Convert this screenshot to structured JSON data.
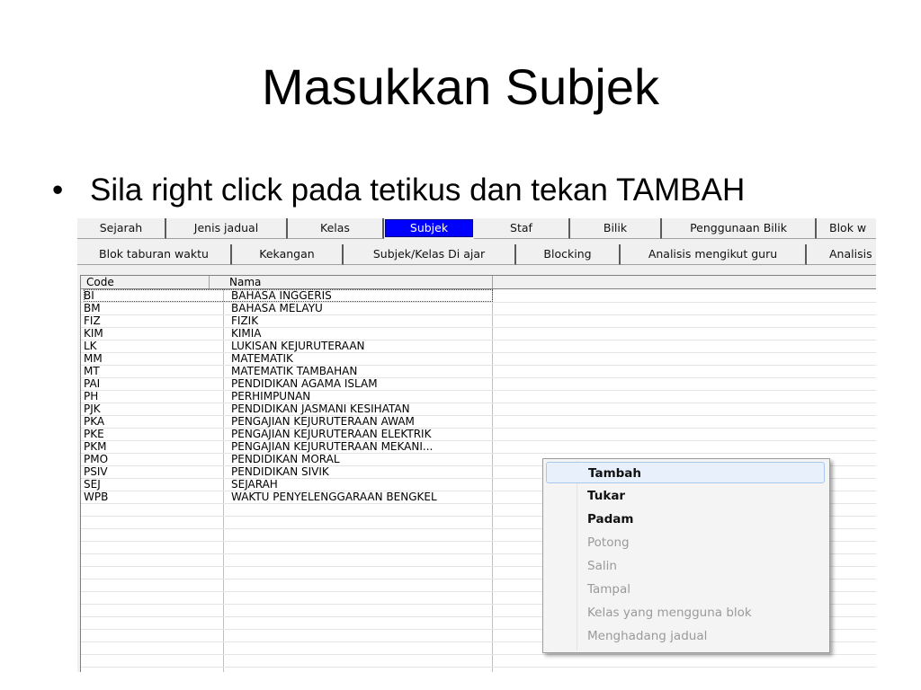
{
  "slide": {
    "title": "Masukkan Subjek",
    "bullet": "•",
    "instruction": "Sila right click pada tetikus dan tekan TAMBAH"
  },
  "tabs_row1": [
    "Sejarah",
    "Jenis jadual",
    "Kelas",
    "Subjek",
    "Staf",
    "Bilik",
    "Penggunaan Bilik",
    "Blok w"
  ],
  "tabs_row1_active": "Subjek",
  "tabs_row2": [
    "Blok taburan waktu",
    "Kekangan",
    "Subjek/Kelas Di ajar",
    "Blocking",
    "Analisis mengikut guru",
    "Analisis"
  ],
  "grid": {
    "columns": [
      "Code",
      "Nama"
    ],
    "rows": [
      [
        "BI",
        "BAHASA INGGERIS"
      ],
      [
        "BM",
        "BAHASA MELAYU"
      ],
      [
        "FIZ",
        "FIZIK"
      ],
      [
        "KIM",
        "KIMIA"
      ],
      [
        "LK",
        "LUKISAN KEJURUTERAAN"
      ],
      [
        "MM",
        "MATEMATIK"
      ],
      [
        "MT",
        "MATEMATIK TAMBAHAN"
      ],
      [
        "PAI",
        "PENDIDIKAN AGAMA ISLAM"
      ],
      [
        "PH",
        "PERHIMPUNAN"
      ],
      [
        "PJK",
        "PENDIDIKAN JASMANI KESIHATAN"
      ],
      [
        "PKA",
        "PENGAJIAN KEJURUTERAAN AWAM"
      ],
      [
        "PKE",
        "PENGAJIAN KEJURUTERAAN ELEKTRIK"
      ],
      [
        "PKM",
        "PENGAJIAN KEJURUTERAAN MEKANI..."
      ],
      [
        "PMO",
        "PENDIDIKAN MORAL"
      ],
      [
        "PSIV",
        "PENDIDIKAN SIVIK"
      ],
      [
        "SEJ",
        "SEJARAH"
      ],
      [
        "WPB",
        "WAKTU PENYELENGGARAAN BENGKEL"
      ]
    ]
  },
  "context_menu": {
    "items": [
      {
        "label": "Tambah",
        "state": "highlighted"
      },
      {
        "label": "Tukar",
        "state": "enabled"
      },
      {
        "label": "Padam",
        "state": "enabled"
      },
      {
        "label": "Potong",
        "state": "disabled"
      },
      {
        "label": "Salin",
        "state": "disabled"
      },
      {
        "label": "Tampal",
        "state": "disabled"
      },
      {
        "label": "Kelas yang mengguna blok",
        "state": "disabled"
      },
      {
        "label": "Menghadang jadual",
        "state": "disabled"
      }
    ]
  },
  "colors": {
    "active_tab": "#0000ff",
    "menu_highlight": "#e8f1fb",
    "disabled_text": "#9a9a9a"
  }
}
